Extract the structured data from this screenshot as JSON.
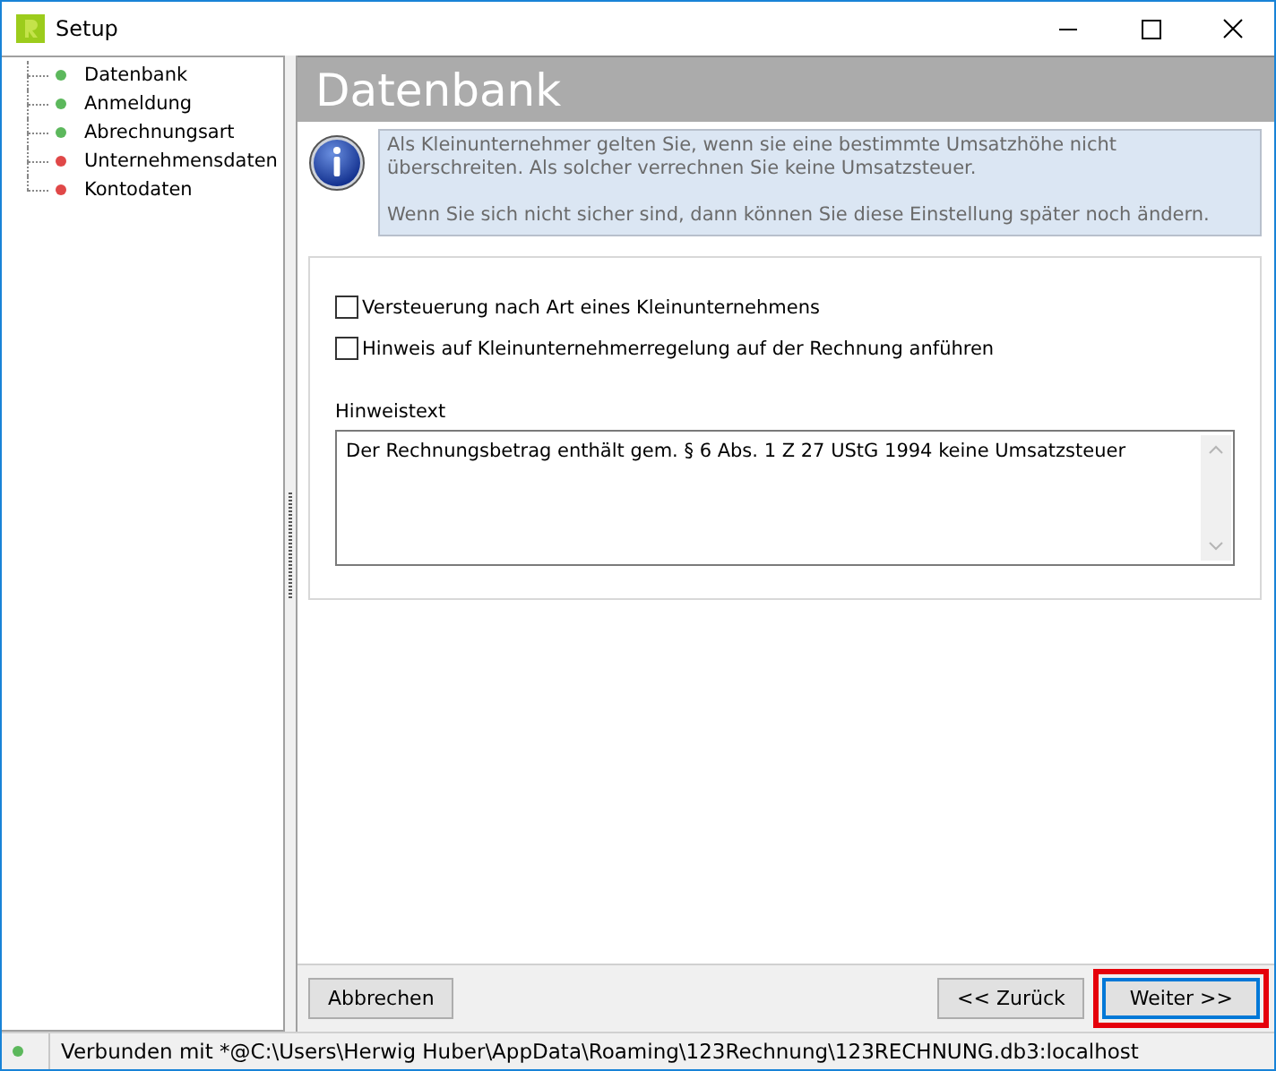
{
  "window": {
    "title": "Setup"
  },
  "sidebar": {
    "items": [
      {
        "label": "Datenbank",
        "color": "#5cb85c"
      },
      {
        "label": "Anmeldung",
        "color": "#5cb85c"
      },
      {
        "label": "Abrechnungsart",
        "color": "#5cb85c"
      },
      {
        "label": "Unternehmensdaten",
        "color": "#e04848"
      },
      {
        "label": "Kontodaten",
        "color": "#e04848"
      }
    ]
  },
  "header": "Datenbank",
  "info": {
    "paragraphs": [
      "Als Kleinunternehmer gelten Sie, wenn sie eine bestimmte Umsatzhöhe nicht überschreiten. Als solcher verrechnen Sie keine Umsatzsteuer.",
      "Wenn Sie sich nicht sicher sind, dann können Sie diese Einstellung später noch ändern."
    ]
  },
  "checkboxes": [
    {
      "label": "Versteuerung nach Art eines Kleinunternehmens",
      "checked": false
    },
    {
      "label": "Hinweis auf Kleinunternehmerregelung auf der Rechnung anführen",
      "checked": false
    }
  ],
  "note": {
    "label": "Hinweistext",
    "value": "Der Rechnungsbetrag enthält gem. § 6 Abs. 1 Z 27 UStG 1994 keine Umsatzsteuer"
  },
  "buttons": [
    {
      "label": "Abbrechen",
      "kind": "left",
      "highlighted": false
    },
    {
      "label": "<< Zurück",
      "kind": "right",
      "highlighted": false
    },
    {
      "label": "Weiter >>",
      "kind": "right",
      "highlighted": true
    }
  ],
  "status_bar": {
    "color": "#5cb85c",
    "text": "Verbunden mit *@C:\\Users\\Herwig Huber\\AppData\\Roaming\\123Rechnung\\123RECHNUNG.db3:localhost"
  }
}
